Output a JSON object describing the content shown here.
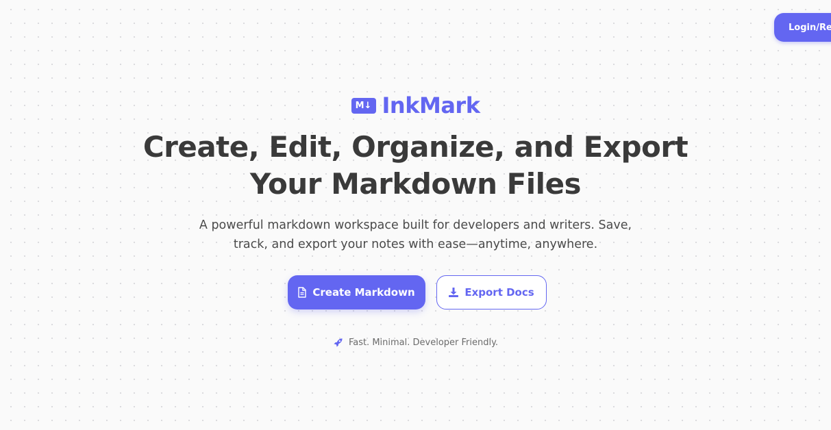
{
  "header": {
    "login_label": "Login/Register"
  },
  "brand": {
    "icon_text": "M↓",
    "name": "InkMark"
  },
  "hero": {
    "headline": "Create, Edit, Organize, and Export Your Markdown Files",
    "subtitle": "A powerful markdown workspace built for developers and writers. Save, track, and export your notes with ease—anytime, anywhere.",
    "primary_cta": "Create Markdown",
    "primary_cta_icon": "document-icon",
    "secondary_cta": "Export Docs",
    "secondary_cta_icon": "download-icon",
    "tagline": "Fast. Minimal. Developer Friendly.",
    "tagline_icon": "rocket-icon"
  },
  "colors": {
    "accent": "#6366f1",
    "text": "#3a3a3a",
    "background": "#fafafa"
  }
}
